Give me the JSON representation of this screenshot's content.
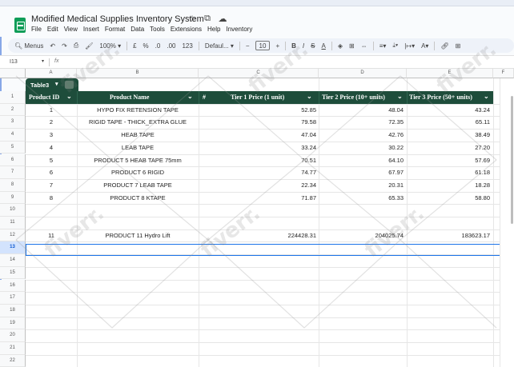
{
  "app": {
    "doc_title": "Modified Medical Supplies Inventory System",
    "menu": [
      "File",
      "Edit",
      "View",
      "Insert",
      "Format",
      "Data",
      "Tools",
      "Extensions",
      "Help",
      "Inventory"
    ]
  },
  "toolbar": {
    "search_label": "Menus",
    "zoom": "100%",
    "currency": "£",
    "percent": "%",
    "decimal_less": ".0",
    "decimal_more": ".00",
    "number_format": "123",
    "font": "Defaul...",
    "font_size": "10",
    "minus": "−",
    "plus": "+",
    "bold": "B",
    "italic": "I"
  },
  "formula_bar": {
    "cell_ref": "I13",
    "fx": "fx"
  },
  "columns": [
    "A",
    "B",
    "C",
    "D",
    "E",
    "F"
  ],
  "rows": [
    "1",
    "2",
    "3",
    "4",
    "5",
    "6",
    "7",
    "8",
    "9",
    "10",
    "11",
    "12",
    "13",
    "14",
    "15",
    "16",
    "17",
    "18",
    "19",
    "20",
    "21",
    "22"
  ],
  "selected_row": "13",
  "table": {
    "name": "Table3",
    "headers": {
      "id": "Product ID",
      "name": "Product Name",
      "hash": "#",
      "tier1": "Tier 1 Price (1 unit)",
      "tier2": "Tier 2 Price (10+ units)",
      "tier3": "Tier 3 Price (50+ units)"
    },
    "rows": [
      {
        "id": "1",
        "name": "HYPO FIX RETENSION TAPE",
        "tier1": "52.85",
        "tier2": "48.04",
        "tier3": "43.24"
      },
      {
        "id": "2",
        "name": "RIGID TAPE - THICK_EXTRA GLUE",
        "tier1": "79.58",
        "tier2": "72.35",
        "tier3": "65.11"
      },
      {
        "id": "3",
        "name": "HEAB TAPE",
        "tier1": "47.04",
        "tier2": "42.76",
        "tier3": "38.49"
      },
      {
        "id": "4",
        "name": "LEAB TAPE",
        "tier1": "33.24",
        "tier2": "30.22",
        "tier3": "27.20"
      },
      {
        "id": "5",
        "name": "PRODUCT 5 HEAB TAPE 75mm",
        "tier1": "70.51",
        "tier2": "64.10",
        "tier3": "57.69"
      },
      {
        "id": "6",
        "name": "PRODUCT 6 RIGID",
        "tier1": "74.77",
        "tier2": "67.97",
        "tier3": "61.18"
      },
      {
        "id": "7",
        "name": "PRODUCT 7 LEAB TAPE",
        "tier1": "22.34",
        "tier2": "20.31",
        "tier3": "18.28"
      },
      {
        "id": "8",
        "name": "PRODUCT 8 KTAPE",
        "tier1": "71.87",
        "tier2": "65.33",
        "tier3": "58.80"
      },
      {
        "id": "",
        "name": "",
        "tier1": "",
        "tier2": "",
        "tier3": ""
      },
      {
        "id": "",
        "name": "",
        "tier1": "",
        "tier2": "",
        "tier3": ""
      },
      {
        "id": "11",
        "name": "PRODUCT 11 Hydro Lift",
        "tier1": "224428.31",
        "tier2": "204025.74",
        "tier3": "183623.17"
      }
    ]
  },
  "watermark": "fiverr.",
  "colors": {
    "table_header": "#1e4d3b",
    "selection": "#1a73e8",
    "sheets_green": "#0f9d58"
  }
}
